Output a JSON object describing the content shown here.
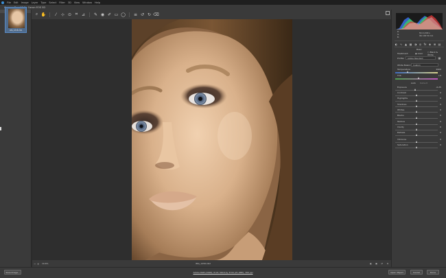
{
  "app": {
    "menu": [
      "File",
      "Edit",
      "Image",
      "Layer",
      "Type",
      "Select",
      "Filter",
      "3D",
      "View",
      "Window",
      "Help"
    ],
    "title": "Camera Raw 10.0  -  Canon EOS 5D"
  },
  "filmstrip": {
    "header": "Filmstrip",
    "thumb_caption": "IMG_1058.CR2",
    "thumb_stars": "• • • • •"
  },
  "image": {
    "filename": "IMG_1058.CR2",
    "zoom": "19.6%"
  },
  "histogram": {
    "readout_left": [
      "R:",
      "G:",
      "B:"
    ],
    "readout_right": [
      "f/11  1/100 s",
      "ISO 100  50 mm"
    ],
    "colors": {
      "red": "#e23b3b",
      "green": "#3bd65a",
      "blue": "#3b6fe6",
      "white": "#f2f2f2"
    }
  },
  "panel": {
    "section_title": "Basic",
    "treatment_label": "Treatment:",
    "treatment_options": [
      "Color",
      "Black & White"
    ],
    "profile_label": "Profile:",
    "profile_value": "Adobe Standard",
    "wb_label": "White Balance:",
    "wb_value": "Custom",
    "temperature": {
      "label": "Temperature",
      "value": "4900",
      "position": 0.3
    },
    "tint": {
      "label": "Tint",
      "value": "+9",
      "position": 0.55
    },
    "auto_label": "Auto",
    "default_label": "Default",
    "tone_sliders": [
      {
        "label": "Exposure",
        "value": "-0.25",
        "position": 0.48
      },
      {
        "label": "Contrast",
        "value": "0",
        "position": 0.5
      },
      {
        "label": "Highlights",
        "value": "0",
        "position": 0.5
      },
      {
        "label": "Shadows",
        "value": "0",
        "position": 0.5
      },
      {
        "label": "Whites",
        "value": "0",
        "position": 0.5
      },
      {
        "label": "Blacks",
        "value": "0",
        "position": 0.5
      }
    ],
    "presence_sliders": [
      {
        "label": "Texture",
        "value": "0",
        "position": 0.5
      },
      {
        "label": "Clarity",
        "value": "0",
        "position": 0.5
      },
      {
        "label": "Dehaze",
        "value": "0",
        "position": 0.5
      }
    ],
    "color_sliders": [
      {
        "label": "Vibrance",
        "value": "0",
        "position": 0.5
      },
      {
        "label": "Saturation",
        "value": "0",
        "position": 0.5
      }
    ]
  },
  "bottom": {
    "save_label": "Save Image...",
    "workflow_link": "Adobe RGB (1998); 8 bit; 5616 by 3744 (21.0MP); 300 ppi",
    "open_label": "Open Object",
    "cancel_label": "Cancel",
    "done_label": "Done"
  }
}
